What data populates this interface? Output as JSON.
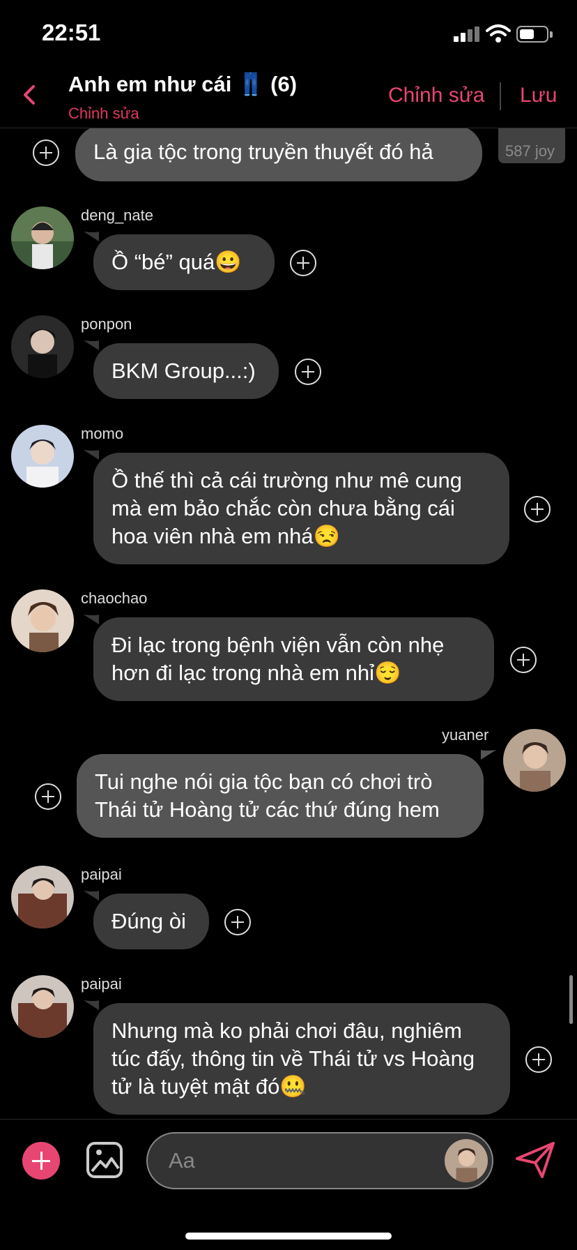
{
  "status_bar": {
    "time": "22:51"
  },
  "header": {
    "title": "Anh em như cái 👖 (6)",
    "subtitle": "Chỉnh sửa",
    "edit_label": "Chỉnh sửa",
    "save_label": "Lưu"
  },
  "messages": [
    {
      "sender": "",
      "text": "Là gia tộc trong truyền thuyết đó hả",
      "side": "right"
    },
    {
      "sender": "deng_nate",
      "text": "Ồ “bé” quá😀",
      "side": "left"
    },
    {
      "sender": "ponpon",
      "text": "BKM Group...:)",
      "side": "left"
    },
    {
      "sender": "momo",
      "text": "Ồ thế thì cả cái trường như mê cung mà em bảo chắc còn chưa bằng cái hoa viên nhà em nhá😒",
      "side": "left"
    },
    {
      "sender": "chaochao",
      "text": "Đi lạc trong bệnh viện vẫn còn nhẹ hơn đi lạc trong nhà em nhỉ😌",
      "side": "left"
    },
    {
      "sender": "yuaner",
      "text": "Tui nghe nói gia tộc bạn có chơi trò Thái tử Hoàng tử các thứ đúng hem",
      "side": "right"
    },
    {
      "sender": "paipai",
      "text": "Đúng òi",
      "side": "left"
    },
    {
      "sender": "paipai",
      "text": "Nhưng mà ko phải chơi đâu, nghiêm túc đấy, thông tin về Thái tử vs Hoàng tử là tuyệt mật đó🤐",
      "side": "left"
    }
  ],
  "seen_label": "587 joy",
  "composer": {
    "placeholder": "Aa"
  },
  "colors": {
    "accent": "#e84672",
    "bubble_left": "#3a3a3a",
    "bubble_right": "#555555",
    "background": "#000000"
  },
  "icons": [
    "back-chevron-icon",
    "add-reaction-icon",
    "image-icon",
    "send-icon",
    "plus-icon"
  ]
}
